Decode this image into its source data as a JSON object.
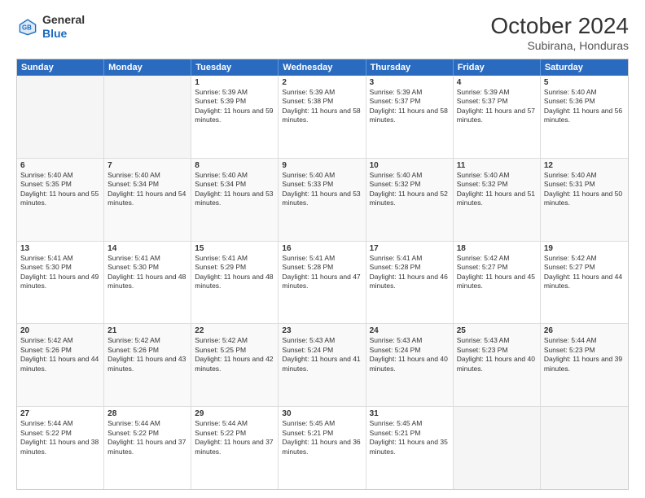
{
  "logo": {
    "general": "General",
    "blue": "Blue"
  },
  "title": {
    "month_year": "October 2024",
    "location": "Subirana, Honduras"
  },
  "header_days": [
    "Sunday",
    "Monday",
    "Tuesday",
    "Wednesday",
    "Thursday",
    "Friday",
    "Saturday"
  ],
  "weeks": [
    [
      {
        "day": "",
        "info": ""
      },
      {
        "day": "",
        "info": ""
      },
      {
        "day": "1",
        "info": "Sunrise: 5:39 AM\nSunset: 5:39 PM\nDaylight: 11 hours and 59 minutes."
      },
      {
        "day": "2",
        "info": "Sunrise: 5:39 AM\nSunset: 5:38 PM\nDaylight: 11 hours and 58 minutes."
      },
      {
        "day": "3",
        "info": "Sunrise: 5:39 AM\nSunset: 5:37 PM\nDaylight: 11 hours and 58 minutes."
      },
      {
        "day": "4",
        "info": "Sunrise: 5:39 AM\nSunset: 5:37 PM\nDaylight: 11 hours and 57 minutes."
      },
      {
        "day": "5",
        "info": "Sunrise: 5:40 AM\nSunset: 5:36 PM\nDaylight: 11 hours and 56 minutes."
      }
    ],
    [
      {
        "day": "6",
        "info": "Sunrise: 5:40 AM\nSunset: 5:35 PM\nDaylight: 11 hours and 55 minutes."
      },
      {
        "day": "7",
        "info": "Sunrise: 5:40 AM\nSunset: 5:34 PM\nDaylight: 11 hours and 54 minutes."
      },
      {
        "day": "8",
        "info": "Sunrise: 5:40 AM\nSunset: 5:34 PM\nDaylight: 11 hours and 53 minutes."
      },
      {
        "day": "9",
        "info": "Sunrise: 5:40 AM\nSunset: 5:33 PM\nDaylight: 11 hours and 53 minutes."
      },
      {
        "day": "10",
        "info": "Sunrise: 5:40 AM\nSunset: 5:32 PM\nDaylight: 11 hours and 52 minutes."
      },
      {
        "day": "11",
        "info": "Sunrise: 5:40 AM\nSunset: 5:32 PM\nDaylight: 11 hours and 51 minutes."
      },
      {
        "day": "12",
        "info": "Sunrise: 5:40 AM\nSunset: 5:31 PM\nDaylight: 11 hours and 50 minutes."
      }
    ],
    [
      {
        "day": "13",
        "info": "Sunrise: 5:41 AM\nSunset: 5:30 PM\nDaylight: 11 hours and 49 minutes."
      },
      {
        "day": "14",
        "info": "Sunrise: 5:41 AM\nSunset: 5:30 PM\nDaylight: 11 hours and 48 minutes."
      },
      {
        "day": "15",
        "info": "Sunrise: 5:41 AM\nSunset: 5:29 PM\nDaylight: 11 hours and 48 minutes."
      },
      {
        "day": "16",
        "info": "Sunrise: 5:41 AM\nSunset: 5:28 PM\nDaylight: 11 hours and 47 minutes."
      },
      {
        "day": "17",
        "info": "Sunrise: 5:41 AM\nSunset: 5:28 PM\nDaylight: 11 hours and 46 minutes."
      },
      {
        "day": "18",
        "info": "Sunrise: 5:42 AM\nSunset: 5:27 PM\nDaylight: 11 hours and 45 minutes."
      },
      {
        "day": "19",
        "info": "Sunrise: 5:42 AM\nSunset: 5:27 PM\nDaylight: 11 hours and 44 minutes."
      }
    ],
    [
      {
        "day": "20",
        "info": "Sunrise: 5:42 AM\nSunset: 5:26 PM\nDaylight: 11 hours and 44 minutes."
      },
      {
        "day": "21",
        "info": "Sunrise: 5:42 AM\nSunset: 5:26 PM\nDaylight: 11 hours and 43 minutes."
      },
      {
        "day": "22",
        "info": "Sunrise: 5:42 AM\nSunset: 5:25 PM\nDaylight: 11 hours and 42 minutes."
      },
      {
        "day": "23",
        "info": "Sunrise: 5:43 AM\nSunset: 5:24 PM\nDaylight: 11 hours and 41 minutes."
      },
      {
        "day": "24",
        "info": "Sunrise: 5:43 AM\nSunset: 5:24 PM\nDaylight: 11 hours and 40 minutes."
      },
      {
        "day": "25",
        "info": "Sunrise: 5:43 AM\nSunset: 5:23 PM\nDaylight: 11 hours and 40 minutes."
      },
      {
        "day": "26",
        "info": "Sunrise: 5:44 AM\nSunset: 5:23 PM\nDaylight: 11 hours and 39 minutes."
      }
    ],
    [
      {
        "day": "27",
        "info": "Sunrise: 5:44 AM\nSunset: 5:22 PM\nDaylight: 11 hours and 38 minutes."
      },
      {
        "day": "28",
        "info": "Sunrise: 5:44 AM\nSunset: 5:22 PM\nDaylight: 11 hours and 37 minutes."
      },
      {
        "day": "29",
        "info": "Sunrise: 5:44 AM\nSunset: 5:22 PM\nDaylight: 11 hours and 37 minutes."
      },
      {
        "day": "30",
        "info": "Sunrise: 5:45 AM\nSunset: 5:21 PM\nDaylight: 11 hours and 36 minutes."
      },
      {
        "day": "31",
        "info": "Sunrise: 5:45 AM\nSunset: 5:21 PM\nDaylight: 11 hours and 35 minutes."
      },
      {
        "day": "",
        "info": ""
      },
      {
        "day": "",
        "info": ""
      }
    ]
  ]
}
